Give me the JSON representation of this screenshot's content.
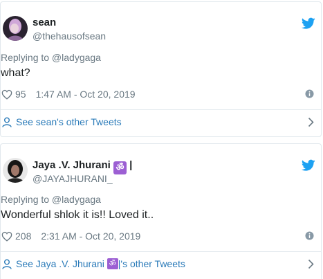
{
  "colors": {
    "link": "#2b7bb9",
    "muted": "#697882",
    "twitter_blue": "#1da1f2",
    "om_badge": "#9c5fd3"
  },
  "tweets": [
    {
      "name": "sean",
      "handle": "@thehausofsean",
      "replying_to": "Replying to @ladygaga",
      "text": "what?",
      "likes": "95",
      "timestamp": "1:47 AM - Oct 20, 2019",
      "footer": "See sean's other Tweets",
      "icons": [
        "heart-icon",
        "info-icon",
        "person-icon",
        "chevron-right-icon",
        "twitter-bird-icon"
      ]
    },
    {
      "name_prefix": "Jaya .V. Jhurani ",
      "name_emoji": "ॐ",
      "name_suffix": " |",
      "handle": "@JAYAJHURANI_",
      "replying_to": "Replying to @ladygaga",
      "text": "Wonderful shlok it is!! Loved it..",
      "likes": "208",
      "timestamp": "2:31 AM - Oct 20, 2019",
      "footer_prefix": "See Jaya .V. Jhurani ",
      "footer_emoji": "ॐ",
      "footer_suffix": " |'s other Tweets",
      "icons": [
        "heart-icon",
        "info-icon",
        "person-icon",
        "chevron-right-icon",
        "twitter-bird-icon"
      ]
    }
  ]
}
